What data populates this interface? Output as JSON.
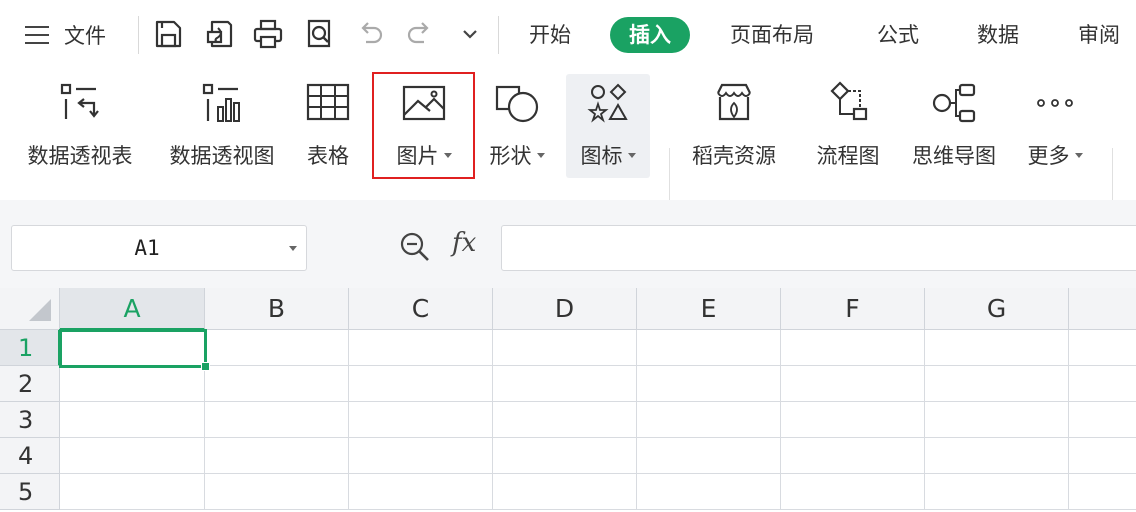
{
  "menubar": {
    "file_label": "文件",
    "tabs": [
      {
        "label": "开始",
        "active": false
      },
      {
        "label": "插入",
        "active": true
      },
      {
        "label": "页面布局",
        "active": false
      },
      {
        "label": "公式",
        "active": false
      },
      {
        "label": "数据",
        "active": false
      },
      {
        "label": "审阅",
        "active": false
      }
    ],
    "quick_access_icons": [
      "save-icon",
      "export-pdf-icon",
      "print-icon",
      "print-preview-icon",
      "undo-icon",
      "redo-icon",
      "customize-dropdown-icon"
    ]
  },
  "ribbon": {
    "items": [
      {
        "label": "数据透视表",
        "icon": "pivot-table-icon",
        "dropdown": false
      },
      {
        "label": "数据透视图",
        "icon": "pivot-chart-icon",
        "dropdown": false
      },
      {
        "label": "表格",
        "icon": "table-icon",
        "dropdown": false
      },
      {
        "label": "图片",
        "icon": "picture-icon",
        "dropdown": true,
        "highlighted": true
      },
      {
        "label": "形状",
        "icon": "shapes-icon",
        "dropdown": true
      },
      {
        "label": "图标",
        "icon": "icons-library-icon",
        "dropdown": true
      },
      {
        "label": "稻壳资源",
        "icon": "docer-resources-icon",
        "dropdown": false
      },
      {
        "label": "流程图",
        "icon": "flowchart-icon",
        "dropdown": false
      },
      {
        "label": "思维导图",
        "icon": "mind-map-icon",
        "dropdown": false
      },
      {
        "label": "更多",
        "icon": "more-icon",
        "dropdown": true
      }
    ]
  },
  "formula_bar": {
    "name_box_value": "A1",
    "function_label": "fx",
    "formula_value": ""
  },
  "sheet": {
    "columns": [
      "A",
      "B",
      "C",
      "D",
      "E",
      "F",
      "G"
    ],
    "rows": [
      "1",
      "2",
      "3",
      "4",
      "5"
    ],
    "active_cell": "A1"
  },
  "colors": {
    "accent": "#1aa263",
    "highlight_box": "#e02020"
  }
}
